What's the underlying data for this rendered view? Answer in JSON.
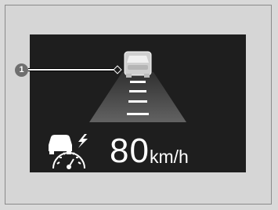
{
  "callout": {
    "number": "1"
  },
  "display": {
    "speed_value": "80",
    "speed_unit": "km/h"
  },
  "icons": {
    "lead_vehicle": "car-icon",
    "adaptive_cruise": "acc-speedometer-icon"
  },
  "colors": {
    "screen_bg": "#1e1e1e",
    "text": "#ffffff",
    "lane_marks": "#ffffff",
    "beam": "#8c8c8c"
  }
}
